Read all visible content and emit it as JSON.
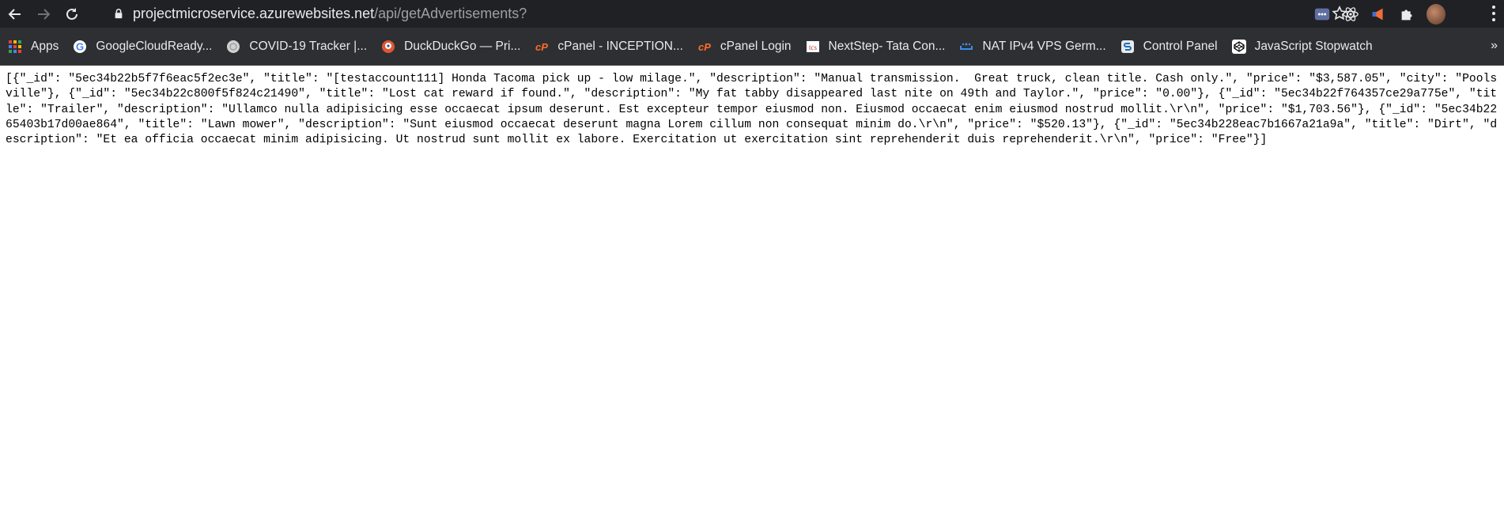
{
  "browser": {
    "url_host": "projectmicroservice.azurewebsites.net",
    "url_path": "/api/getAdvertisements?",
    "nav": {
      "back_icon": "arrow-left-icon",
      "forward_icon": "arrow-right-icon",
      "reload_icon": "reload-icon"
    }
  },
  "bookmarks": [
    {
      "label": "Apps",
      "icon": "apps-grid-icon"
    },
    {
      "label": "GoogleCloudReady...",
      "icon": "google-icon"
    },
    {
      "label": "COVID-19 Tracker |...",
      "icon": "globe-icon"
    },
    {
      "label": "DuckDuckGo — Pri...",
      "icon": "duckduckgo-icon"
    },
    {
      "label": "cPanel - INCEPTION...",
      "icon": "cpanel-icon"
    },
    {
      "label": "cPanel Login",
      "icon": "cpanel-icon"
    },
    {
      "label": "NextStep- Tata Con...",
      "icon": "tcs-icon"
    },
    {
      "label": "NAT IPv4 VPS Germ...",
      "icon": "nat-icon"
    },
    {
      "label": "Control Panel",
      "icon": "control-panel-icon"
    },
    {
      "label": "JavaScript Stopwatch",
      "icon": "codepen-icon"
    }
  ],
  "bookmarks_more": "»",
  "body_text": "[{\"_id\": \"5ec34b22b5f7f6eac5f2ec3e\", \"title\": \"[testaccount111] Honda Tacoma pick up - low milage.\", \"description\": \"Manual transmission.  Great truck, clean title. Cash only.\", \"price\": \"$3,587.05\", \"city\": \"Poolsville\"}, {\"_id\": \"5ec34b22c800f5f824c21490\", \"title\": \"Lost cat reward if found.\", \"description\": \"My fat tabby disappeared last nite on 49th and Taylor.\", \"price\": \"0.00\"}, {\"_id\": \"5ec34b22f764357ce29a775e\", \"title\": \"Trailer\", \"description\": \"Ullamco nulla adipisicing esse occaecat ipsum deserunt. Est excepteur tempor eiusmod non. Eiusmod occaecat enim eiusmod nostrud mollit.\\r\\n\", \"price\": \"$1,703.56\"}, {\"_id\": \"5ec34b2265403b17d00ae864\", \"title\": \"Lawn mower\", \"description\": \"Sunt eiusmod occaecat deserunt magna Lorem cillum non consequat minim do.\\r\\n\", \"price\": \"$520.13\"}, {\"_id\": \"5ec34b228eac7b1667a21a9a\", \"title\": \"Dirt\", \"description\": \"Et ea officia occaecat minim adipisicing. Ut nostrud sunt mollit ex labore. Exercitation ut exercitation sint reprehenderit duis reprehenderit.\\r\\n\", \"price\": \"Free\"}]"
}
